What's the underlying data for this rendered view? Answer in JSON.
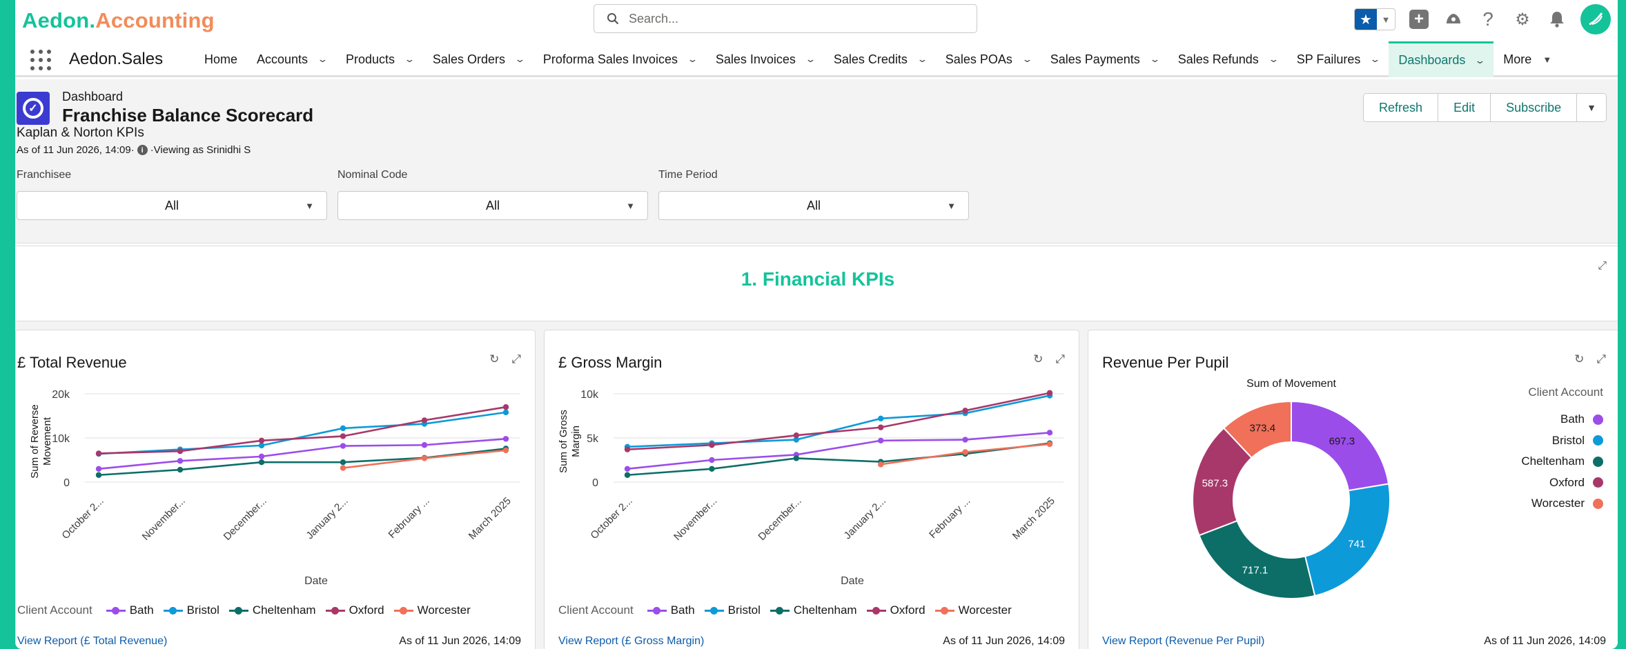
{
  "brand": {
    "part1": "Aedon.",
    "part2": "Accounting"
  },
  "search": {
    "placeholder": "Search..."
  },
  "nav": {
    "app_name": "Aedon.Sales",
    "items": [
      {
        "label": "Home",
        "chevron": false
      },
      {
        "label": "Accounts",
        "chevron": true
      },
      {
        "label": "Products",
        "chevron": true
      },
      {
        "label": "Sales Orders",
        "chevron": true
      },
      {
        "label": "Proforma Sales Invoices",
        "chevron": true
      },
      {
        "label": "Sales Invoices",
        "chevron": true
      },
      {
        "label": "Sales Credits",
        "chevron": true
      },
      {
        "label": "Sales POAs",
        "chevron": true
      },
      {
        "label": "Sales Payments",
        "chevron": true
      },
      {
        "label": "Sales Refunds",
        "chevron": true
      },
      {
        "label": "SP Failures",
        "chevron": true
      },
      {
        "label": "Dashboards",
        "chevron": true,
        "active": true
      }
    ],
    "more_label": "More"
  },
  "dashboard": {
    "type_label": "Dashboard",
    "title": "Franchise Balance Scorecard",
    "subtitle": "Kaplan & Norton KPIs",
    "as_of": "As of 11 Jun 2026, 14:09·",
    "viewing_as": "·Viewing as Srinidhi S",
    "buttons": {
      "refresh": "Refresh",
      "edit": "Edit",
      "subscribe": "Subscribe"
    }
  },
  "filters": [
    {
      "label": "Franchisee",
      "value": "All"
    },
    {
      "label": "Nominal Code",
      "value": "All"
    },
    {
      "label": "Time Period",
      "value": "All"
    }
  ],
  "section": {
    "title": "1. Financial KPIs"
  },
  "colors": {
    "Bath": "#9b4dea",
    "Bristol": "#0d9ad8",
    "Cheltenham": "#0d6e68",
    "Oxford": "#a8386a",
    "Worcester": "#f0705a",
    "accent": "#14c39a"
  },
  "widgets": [
    {
      "title": "£ Total Revenue",
      "link": "View Report (£ Total Revenue)",
      "as_of": "As of 11 Jun 2026, 14:09",
      "legend_title": "Client Account"
    },
    {
      "title": "£ Gross Margin",
      "link": "View Report (£ Gross Margin)",
      "as_of": "As of 11 Jun 2026, 14:09",
      "legend_title": "Client Account"
    },
    {
      "title": "Revenue Per Pupil",
      "link": "View Report (Revenue Per Pupil)",
      "as_of": "As of 11 Jun 2026, 14:09",
      "legend_title": "Client Account"
    }
  ],
  "chart_data": [
    {
      "type": "line",
      "title": "£ Total Revenue",
      "xlabel": "Date",
      "ylabel": "Sum of Reverse Movement",
      "categories": [
        "October 2...",
        "November...",
        "December...",
        "January 2...",
        "February ...",
        "March 2025"
      ],
      "yticks": [
        "0",
        "10k",
        "20k"
      ],
      "ylim": [
        0,
        20000
      ],
      "legend_title": "Client Account",
      "legend_position": "bottom",
      "series": [
        {
          "name": "Bath",
          "values": [
            3000,
            4800,
            5800,
            8200,
            8400,
            9800
          ]
        },
        {
          "name": "Bristol",
          "values": [
            6400,
            7400,
            8300,
            12200,
            13200,
            15800
          ]
        },
        {
          "name": "Cheltenham",
          "values": [
            1600,
            2800,
            4500,
            4500,
            5500,
            7600
          ]
        },
        {
          "name": "Oxford",
          "values": [
            6500,
            7000,
            9400,
            10400,
            14000,
            17000
          ]
        },
        {
          "name": "Worcester",
          "values": [
            null,
            null,
            null,
            3200,
            5400,
            7200
          ]
        }
      ]
    },
    {
      "type": "line",
      "title": "£ Gross Margin",
      "xlabel": "Date",
      "ylabel": "Sum of Gross Margin",
      "categories": [
        "October 2...",
        "November...",
        "December...",
        "January 2...",
        "February ...",
        "March 2025"
      ],
      "yticks": [
        "0",
        "5k",
        "10k"
      ],
      "ylim": [
        0,
        10000
      ],
      "legend_title": "Client Account",
      "legend_position": "bottom",
      "series": [
        {
          "name": "Bath",
          "values": [
            1500,
            2500,
            3100,
            4700,
            4800,
            5600
          ]
        },
        {
          "name": "Bristol",
          "values": [
            4000,
            4400,
            4800,
            7200,
            7800,
            9800
          ]
        },
        {
          "name": "Cheltenham",
          "values": [
            800,
            1500,
            2700,
            2300,
            3200,
            4400
          ]
        },
        {
          "name": "Oxford",
          "values": [
            3700,
            4200,
            5300,
            6200,
            8100,
            10100
          ]
        },
        {
          "name": "Worcester",
          "values": [
            null,
            null,
            null,
            2000,
            3400,
            4300
          ]
        }
      ]
    },
    {
      "type": "pie",
      "donut": true,
      "title": "Sum of Movement",
      "legend_title": "Client Account",
      "legend_position": "right",
      "categories": [
        "Bath",
        "Bristol",
        "Cheltenham",
        "Oxford",
        "Worcester"
      ],
      "values": [
        697.3,
        741,
        717.1,
        587.3,
        373.4
      ]
    }
  ]
}
